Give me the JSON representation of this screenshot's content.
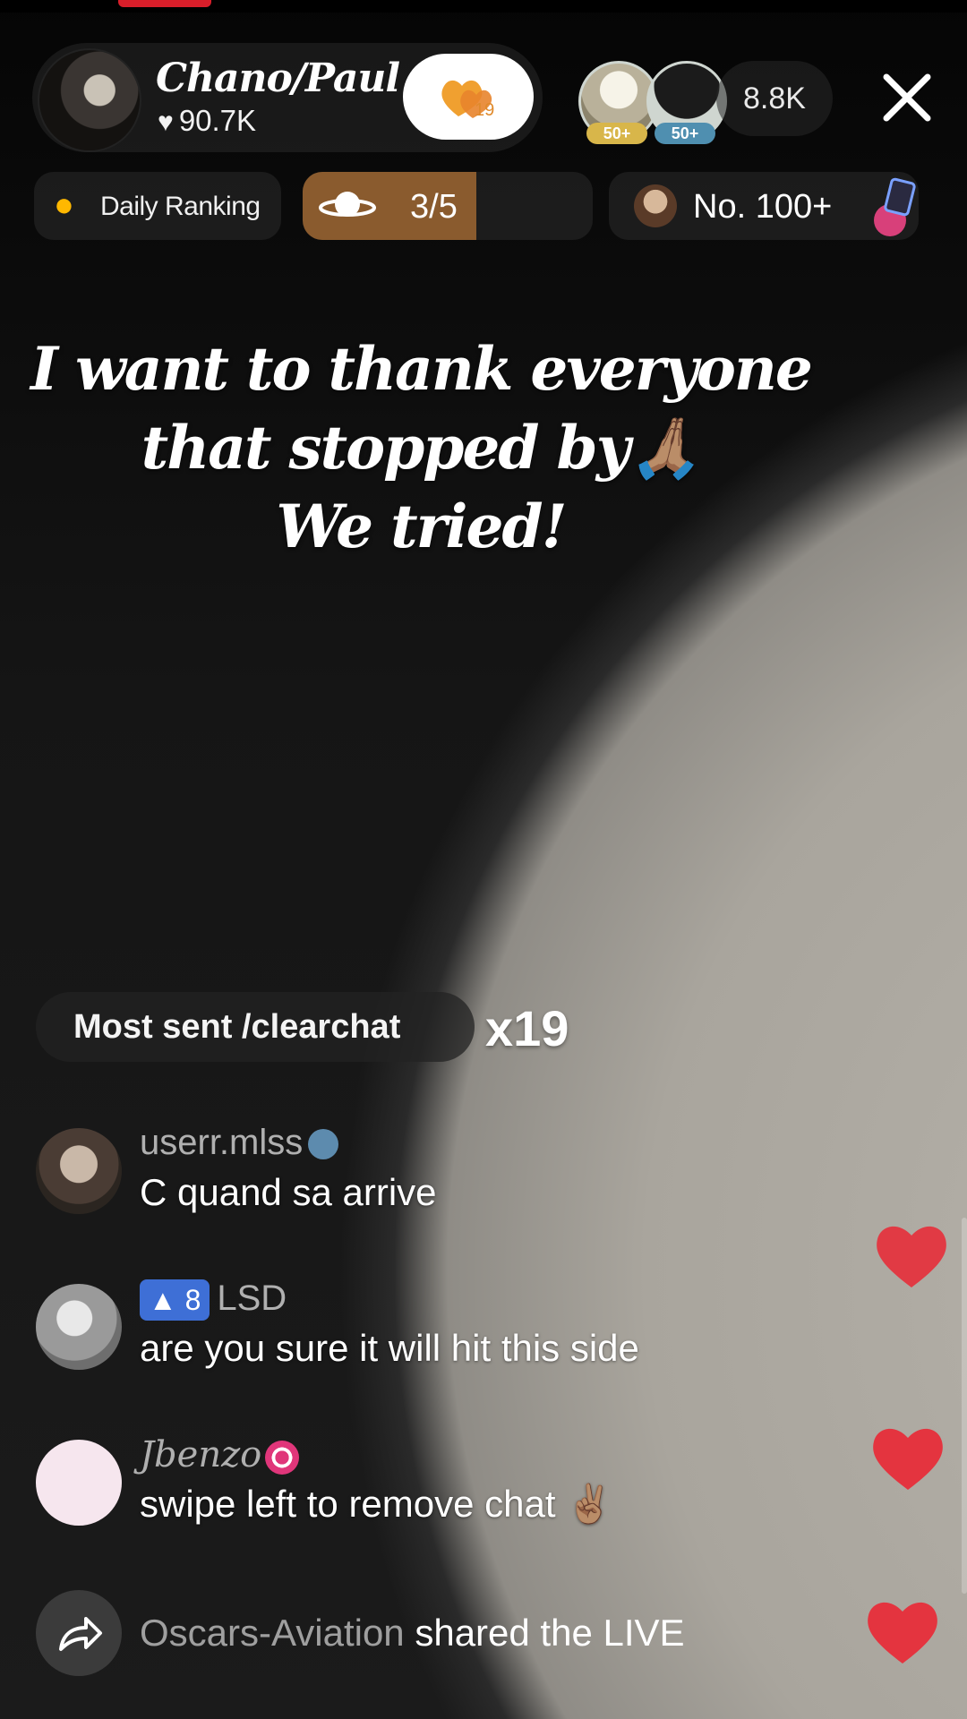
{
  "host": {
    "name": "Chano/Paul",
    "likes": "90.7K",
    "follow_gift_count": "19"
  },
  "viewers": {
    "top_viewer_badges": [
      "50+",
      "50+"
    ],
    "count": "8.8K"
  },
  "rankings": {
    "daily_label": "Daily Ranking",
    "progress_text": "3/5",
    "progress_fraction": 0.6,
    "rank_text": "No. 100+"
  },
  "caption": {
    "line1": "I want to thank everyone",
    "line2": "that stopped by🙏🏽",
    "line3": "We tried!"
  },
  "most_sent": {
    "label": "Most sent /clearchat",
    "count": "x19"
  },
  "chat": [
    {
      "user": "userr.mlss",
      "message": "C quand sa arrive"
    },
    {
      "level": "8",
      "user": "LSD",
      "message": "are you sure it will hit this side"
    },
    {
      "user": "Jbenzo",
      "message": "swipe left to remove chat ✌🏽"
    }
  ],
  "share": {
    "user": "Oscars-Aviation",
    "action": "shared the LIVE"
  },
  "icons": {
    "close": "close-icon",
    "share": "share-icon",
    "heart": "heart-icon",
    "fire": "fire-icon",
    "planet": "planet-icon"
  },
  "colors": {
    "accent_red": "#e4343f",
    "progress_fill": "#8a5b2e",
    "level_badge": "#3e6fd6"
  }
}
